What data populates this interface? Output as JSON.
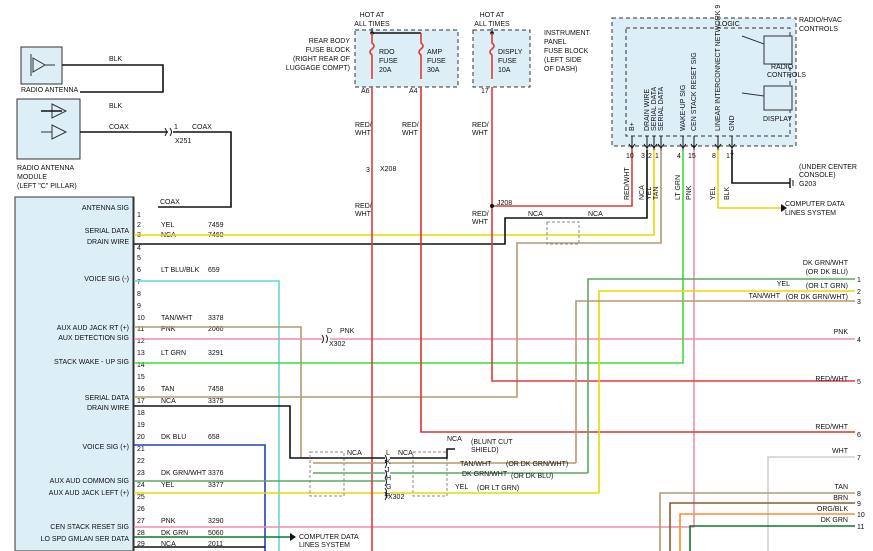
{
  "antenna": {
    "label": "RADIO ANTENNA",
    "wire1": "BLK",
    "wire2": "BLK",
    "coax": "COAX",
    "connector": "X251",
    "pin": "1",
    "coax2": "COAX"
  },
  "antenna_module": {
    "line1": "RADIO ANTENNA",
    "line2": "MODULE",
    "line3": "(LEFT \"C\" PILLAR)"
  },
  "radio": {
    "antenna_sig": "ANTENNA SIG",
    "coax": "COAX",
    "pin_labels": {
      "serial_data_1": "SERIAL DATA",
      "drain_wire_1": "DRAIN WIRE",
      "voice_sig_minus": "VOICE SIG (-)",
      "aux_right": "AUX AUD JACK RT (+)",
      "aux_detect": "AUX DETECTION SIG",
      "stack_wake": "STACK WAKE - UP SIG",
      "serial_data_2": "SERIAL DATA",
      "drain_wire_2": "DRAIN WIRE",
      "voice_sig_plus": "VOICE SIG (+)",
      "aux_common": "AUX AUD COMMON SIG",
      "aux_left": "AUX AUD JACK LEFT (+)",
      "cen_stack": "CEN STACK RESET SIG",
      "lo_spd": "LO SPD GMLAN SER DATA"
    },
    "pins": [
      {
        "n": "1",
        "color": "",
        "circuit": ""
      },
      {
        "n": "2",
        "color": "YEL",
        "circuit": "7459"
      },
      {
        "n": "3",
        "color": "NCA",
        "circuit": "7460"
      },
      {
        "n": "4",
        "color": "",
        "circuit": ""
      },
      {
        "n": "5",
        "color": "",
        "circuit": ""
      },
      {
        "n": "6",
        "color": "LT BLU/BLK",
        "circuit": "659"
      },
      {
        "n": "7",
        "color": "",
        "circuit": ""
      },
      {
        "n": "8",
        "color": "",
        "circuit": ""
      },
      {
        "n": "9",
        "color": "",
        "circuit": ""
      },
      {
        "n": "10",
        "color": "TAN/WHT",
        "circuit": "3378"
      },
      {
        "n": "11",
        "color": "PNK",
        "circuit": "2060"
      },
      {
        "n": "12",
        "color": "",
        "circuit": ""
      },
      {
        "n": "13",
        "color": "LT GRN",
        "circuit": "3291"
      },
      {
        "n": "14",
        "color": "",
        "circuit": ""
      },
      {
        "n": "15",
        "color": "",
        "circuit": ""
      },
      {
        "n": "16",
        "color": "TAN",
        "circuit": "7458"
      },
      {
        "n": "17",
        "color": "NCA",
        "circuit": "3375"
      },
      {
        "n": "18",
        "color": "",
        "circuit": ""
      },
      {
        "n": "19",
        "color": "",
        "circuit": ""
      },
      {
        "n": "20",
        "color": "DK BLU",
        "circuit": "658"
      },
      {
        "n": "21",
        "color": "",
        "circuit": ""
      },
      {
        "n": "22",
        "color": "",
        "circuit": ""
      },
      {
        "n": "23",
        "color": "DK GRN/WHT",
        "circuit": "3376"
      },
      {
        "n": "24",
        "color": "YEL",
        "circuit": "3377"
      },
      {
        "n": "25",
        "color": "",
        "circuit": ""
      },
      {
        "n": "26",
        "color": "",
        "circuit": ""
      },
      {
        "n": "27",
        "color": "PNK",
        "circuit": "3290"
      },
      {
        "n": "28",
        "color": "DK GRN",
        "circuit": "5060"
      },
      {
        "n": "29",
        "color": "NCA",
        "circuit": "2011"
      }
    ],
    "computer_data": {
      "line1": "COMPUTER DATA",
      "line2": "LINES SYSTEM"
    }
  },
  "fuse_rear": {
    "hot1": "HOT AT",
    "hot2": "ALL TIMES",
    "title1": "REAR BODY",
    "title2": "FUSE BLOCK",
    "title3": "(RIGHT REAR OF",
    "title4": "LUGGAGE COMPT)",
    "rdo1": "RDO",
    "rdo2": "FUSE",
    "rdo3": "20A",
    "amp1": "AMP",
    "amp2": "FUSE",
    "amp3": "30A",
    "pinA6": "A6",
    "pinA4": "A4"
  },
  "fuse_ip": {
    "hot1": "HOT AT",
    "hot2": "ALL TIMES",
    "title1": "INSTRUMENT",
    "title2": "PANEL",
    "title3": "FUSE BLOCK",
    "title4": "(LEFT SIDE",
    "title5": "OF DASH)",
    "f1": "DISPLY",
    "f2": "FUSE",
    "f3": "10A",
    "pin17": "17"
  },
  "wires": {
    "red_wht": "RED/",
    "red_wht2": "WHT",
    "x208": "X208",
    "x208pin": "3",
    "j208": "J208",
    "nca": "NCA",
    "redwht_full": "RED/WHT"
  },
  "hvac": {
    "title1": "RADIO/HVAC",
    "title2": "CONTROLS",
    "logic": "LOGIC",
    "radio1": "RADIO",
    "radio2": "CONTROLS",
    "display": "DISPLAY",
    "pins": [
      {
        "label": "B+",
        "n": "10",
        "color": "RED/WHT"
      },
      {
        "label": "DRAIN WIRE",
        "n": "3",
        "color": "NCA"
      },
      {
        "label": "SERIAL DATA",
        "n": "2",
        "color": "YEL"
      },
      {
        "label": "SERIAL DATA",
        "n": "1",
        "color": "TAN"
      },
      {
        "label": "WAKE-UP SIG",
        "n": "4",
        "color": "LT GRN"
      },
      {
        "label": "CEN STACK RESET SIG",
        "n": "15",
        "color": "PNK"
      },
      {
        "label": "LINEAR INTERCONNECT NETWORK 9",
        "n": "8",
        "color": "YEL"
      },
      {
        "label": "GND",
        "n": "17",
        "color": "BLK"
      }
    ],
    "ground1": "(UNDER CENTER",
    "ground2": "CONSOLE)",
    "ground3": "G203",
    "cd1": "COMPUTER DATA",
    "cd2": "LINES SYSTEM"
  },
  "right_side": {
    "r1a": "DK GRN/WHT",
    "r1b": "(OR DK BLU)",
    "r2a": "YEL",
    "r2b": "(OR LT GRN)",
    "r3a": "TAN/WHT",
    "r3b": "(OR DK GRN/WHT)",
    "r4": "PNK",
    "r5": "RED/WHT",
    "r6": "RED/WHT",
    "r7": "WHT",
    "r8": "TAN",
    "r9": "BRN",
    "r10": "ORG/BLK",
    "r11": "DK GRN",
    "nums": [
      "1",
      "2",
      "3",
      "4",
      "5",
      "6",
      "7",
      "8",
      "9",
      "10",
      "11"
    ]
  },
  "x302": {
    "id": "X302",
    "d": "D",
    "pnk": "PNK",
    "blunt1": "(BLUNT CUT",
    "blunt2": "SHIELD)",
    "nca": "NCA",
    "L": "L",
    "K": "K",
    "J": "J",
    "H": "H",
    "G": "G",
    "F": "F",
    "tanwht": "TAN/WHT",
    "or_dkgrnwht": "(OR DK GRN/WHT)",
    "dkgrnwht": "DK GRN/WHT",
    "or_dkblu": "(OR DK BLU)",
    "yel": "YEL",
    "or_ltgrn": "(OR LT GRN)"
  }
}
